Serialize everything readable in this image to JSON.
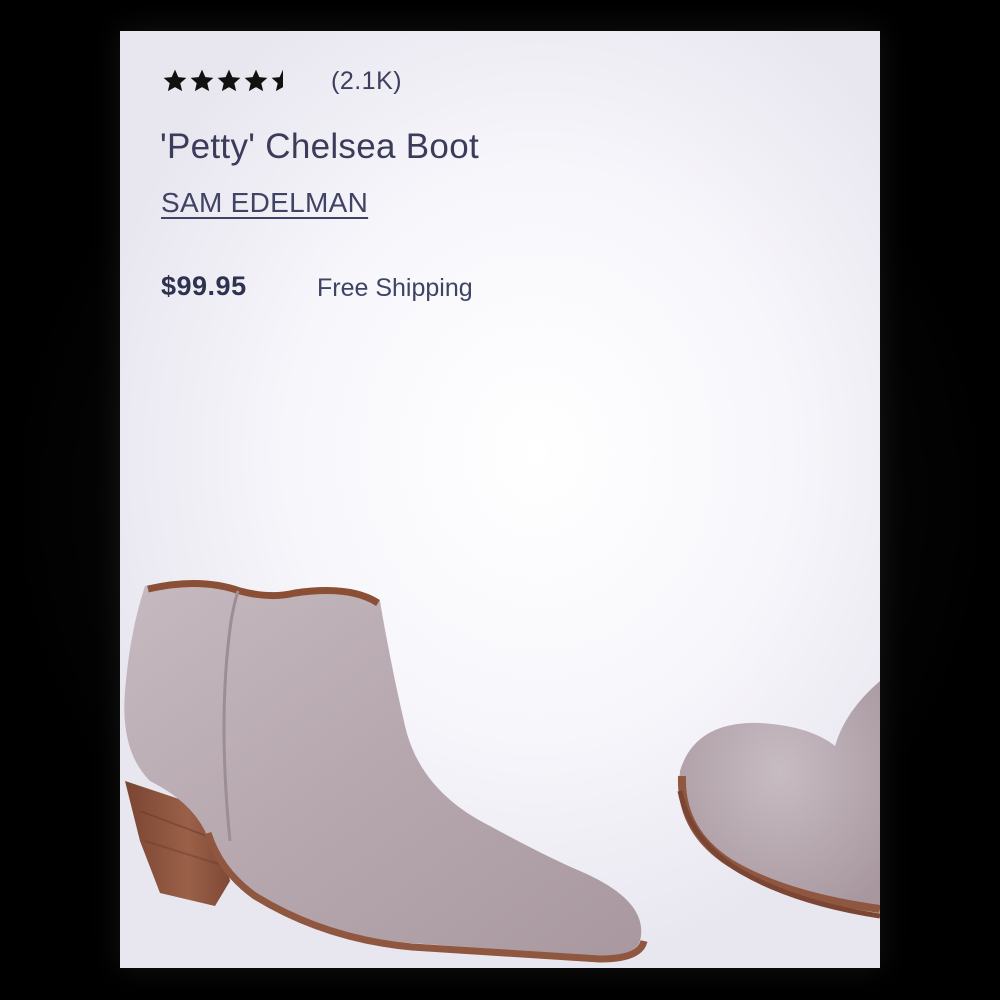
{
  "product": {
    "rating": 4.5,
    "rating_max": 5,
    "review_count": "(2.1K)",
    "title": "'Petty' Chelsea Boot",
    "brand": "SAM EDELMAN",
    "price": "$99.95",
    "shipping": "Free Shipping"
  },
  "icons": {
    "star": "star-icon"
  },
  "colors": {
    "text_primary": "#3a3c5a",
    "price": "#2e3150",
    "boot_suede": "#b8aab2",
    "boot_heel": "#8f5740"
  }
}
